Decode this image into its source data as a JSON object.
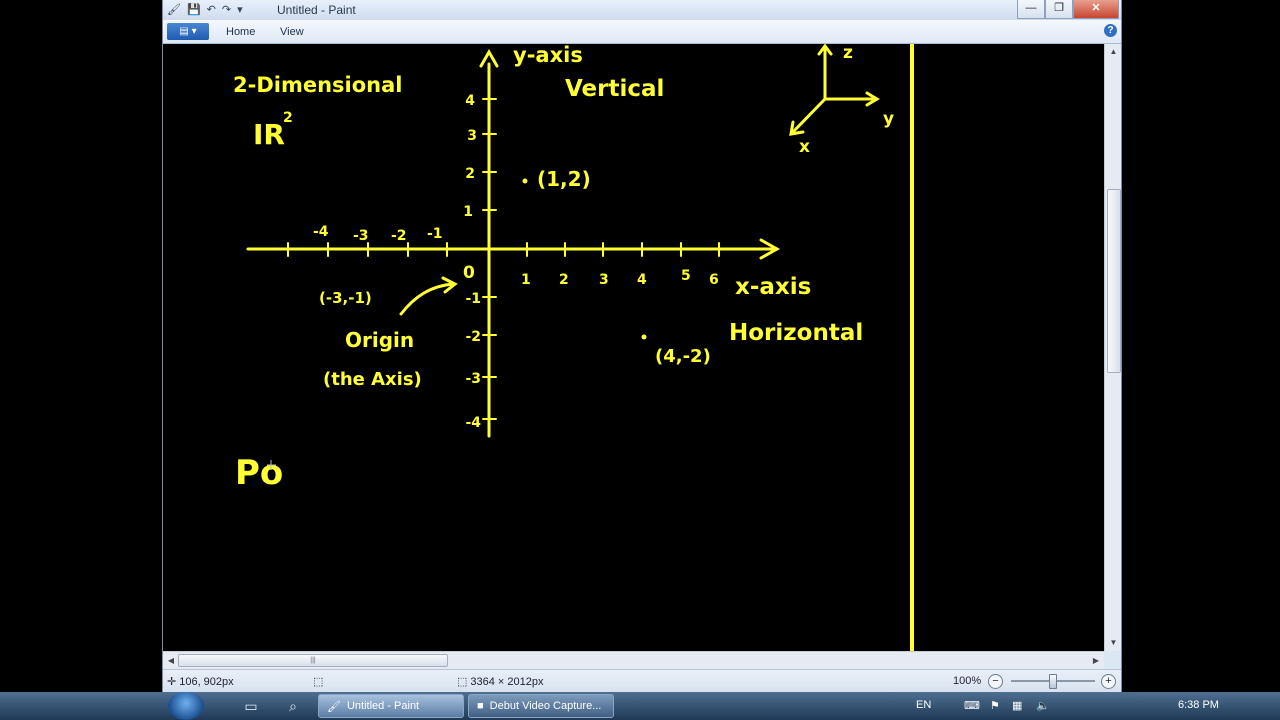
{
  "window": {
    "title": "Untitled - Paint",
    "qat_icons": [
      "paint-app-icon",
      "save-icon",
      "undo-icon",
      "redo-icon",
      "customize-icon"
    ],
    "controls": {
      "minimize": "—",
      "maximize": "❐",
      "close": "✕"
    }
  },
  "ribbon": {
    "app_menu": "▤ ▾",
    "tabs": [
      "Home",
      "View"
    ],
    "help": "?"
  },
  "canvas": {
    "background": "#000000",
    "ink": "#ffff33",
    "texts": {
      "title_line1": "2-Dimensional",
      "title_line2": "IR",
      "title_sup": "2",
      "y_axis_label": "y-axis",
      "vertical_label": "Vertical",
      "x_axis_label": "x-axis",
      "horizontal_label": "Horizontal",
      "origin_label": "Origin",
      "origin_coords": "(the Axis)",
      "zero_label": "0",
      "point_a": "(1,2)",
      "point_b": "(4,-2)",
      "point_c": "(-3,-1)",
      "draft": "Po",
      "axis3d_z": "z",
      "axis3d_y": "y",
      "axis3d_x": "x"
    },
    "x_ticks": [
      "-4",
      "-3",
      "-2",
      "-1",
      "1",
      "2",
      "3",
      "4",
      "5",
      "6"
    ],
    "y_ticks": [
      "4",
      "3",
      "2",
      "1",
      "-1",
      "-2",
      "-3",
      "-4"
    ]
  },
  "status": {
    "cursor_pos": "106, 902px",
    "canvas_size": "3364 × 2012px",
    "zoom": "100%",
    "zoom_level": 0.5
  },
  "taskbar": {
    "items": [
      {
        "label": "Untitled - Paint",
        "active": true
      },
      {
        "label": "Debut Video Capture...",
        "active": false
      }
    ],
    "lang": "EN",
    "time": "6:38 PM"
  }
}
